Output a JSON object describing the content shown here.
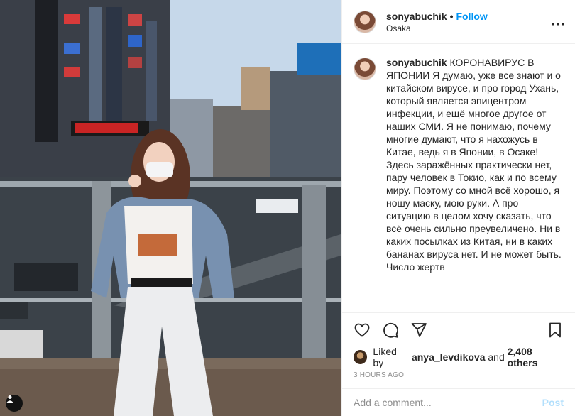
{
  "post": {
    "username": "sonyabuchik",
    "separator": "•",
    "follow_label": "Follow",
    "location": "Osaka",
    "caption_user": "sonyabuchik",
    "caption_text": "КОРОНАВИРУС В ЯПОНИИ Я думаю, уже все знают и о китайском вирусе, и про город Ухань, который является эпицентром инфекции, и ещё многое другое от наших СМИ. Я не понимаю, почему многие думают, что я нахожусь в Китае, ведь я в Японии, в Осаке! Здесь заражённых практически нет, пару человек в Токио, как и по всему миру. Поэтому со мной всё хорошо, я ношу маску, мою руки. А про ситуацию в целом хочу сказать, что всё очень сильно преувеличено. Ни в каких посылках из Китая, ни в каких бананах вируса нет. И не может быть. Число жертв",
    "likes": {
      "prefix": "Liked by",
      "liker": "anya_levdikova",
      "conjunction": "and",
      "others": "2,408 others"
    },
    "timestamp": "3 HOURS AGO"
  },
  "comment": {
    "placeholder": "Add a comment...",
    "post_label": "Post"
  },
  "colors": {
    "accent": "#0095f6",
    "post_disabled": "#b2dffc",
    "text": "#262626",
    "muted": "#8e8e8e",
    "divider": "#efefef"
  },
  "icons": [
    "more-options-icon",
    "heart-icon",
    "comment-icon",
    "share-icon",
    "bookmark-icon",
    "user-tag-icon"
  ]
}
